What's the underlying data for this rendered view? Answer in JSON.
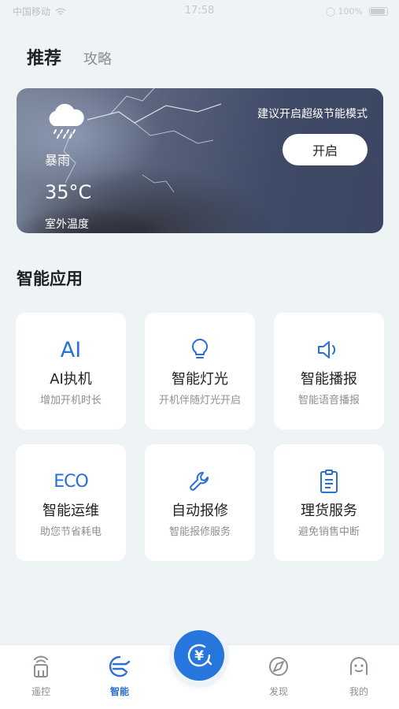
{
  "status_bar": {
    "left": "中国移动",
    "time": "17:58",
    "right": "◯ 100%"
  },
  "tabs": {
    "active": "推荐",
    "other": "攻略"
  },
  "weather": {
    "icon": "rain-cloud-icon",
    "condition": "暴雨",
    "temperature": "35°C",
    "label": "室外温度",
    "tip": "建议开启超级节能模式",
    "button": "开启"
  },
  "section": {
    "title": "智能应用"
  },
  "apps": [
    {
      "icon": "AI",
      "title": "AI执机",
      "subtitle": "增加开机时长"
    },
    {
      "icon": "bulb-icon",
      "title": "智能灯光",
      "subtitle": "开机伴随灯光开启"
    },
    {
      "icon": "speaker-icon",
      "title": "智能播报",
      "subtitle": "智能语音播报"
    },
    {
      "icon": "ECO",
      "title": "智能运维",
      "subtitle": "助您节省耗电"
    },
    {
      "icon": "wrench-icon",
      "title": "自动报修",
      "subtitle": "智能报修服务"
    },
    {
      "icon": "clipboard-icon",
      "title": "理货服务",
      "subtitle": "避免销售中断"
    }
  ],
  "nav": [
    {
      "label": "遥控",
      "icon": "remote-icon"
    },
    {
      "label": "智能",
      "icon": "smart-icon"
    },
    {
      "label": "发现",
      "icon": "discover-icon"
    },
    {
      "label": "我的",
      "icon": "profile-icon"
    }
  ],
  "center_button": {
    "glyph": "¥",
    "icon": "yen-icon"
  },
  "colors": {
    "accent": "#2676de",
    "card_bg": "#ffffff",
    "page_bg": "#eef3f6"
  }
}
